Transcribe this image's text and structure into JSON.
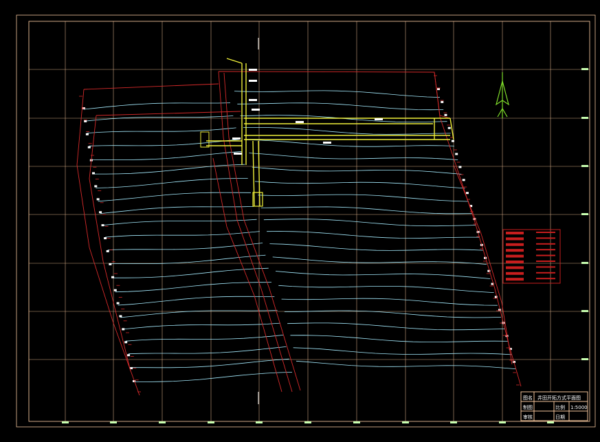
{
  "drawing": {
    "background": "#000000",
    "colors": {
      "frame": "#f2c39a",
      "grid": "#f2c39a",
      "boundary": "#d62a2a",
      "seam": "#a6ecff",
      "roadway": "#f0f03a",
      "markers": "#c8ffb0",
      "north_arrow": "#7fdc2a",
      "legend_fill": "#c81e1e",
      "text": "#ffffff"
    },
    "north_arrow_icon": "north-arrow-icon"
  },
  "title_block": {
    "rows": [
      {
        "label": "图名",
        "value": "井田开拓方式平面图"
      },
      {
        "label": "制图",
        "sub_label": "比例",
        "value": "1:5000"
      },
      {
        "label": "审核",
        "sub_label": "日期",
        "value": ""
      }
    ]
  },
  "legend": {
    "row_count": 9
  }
}
